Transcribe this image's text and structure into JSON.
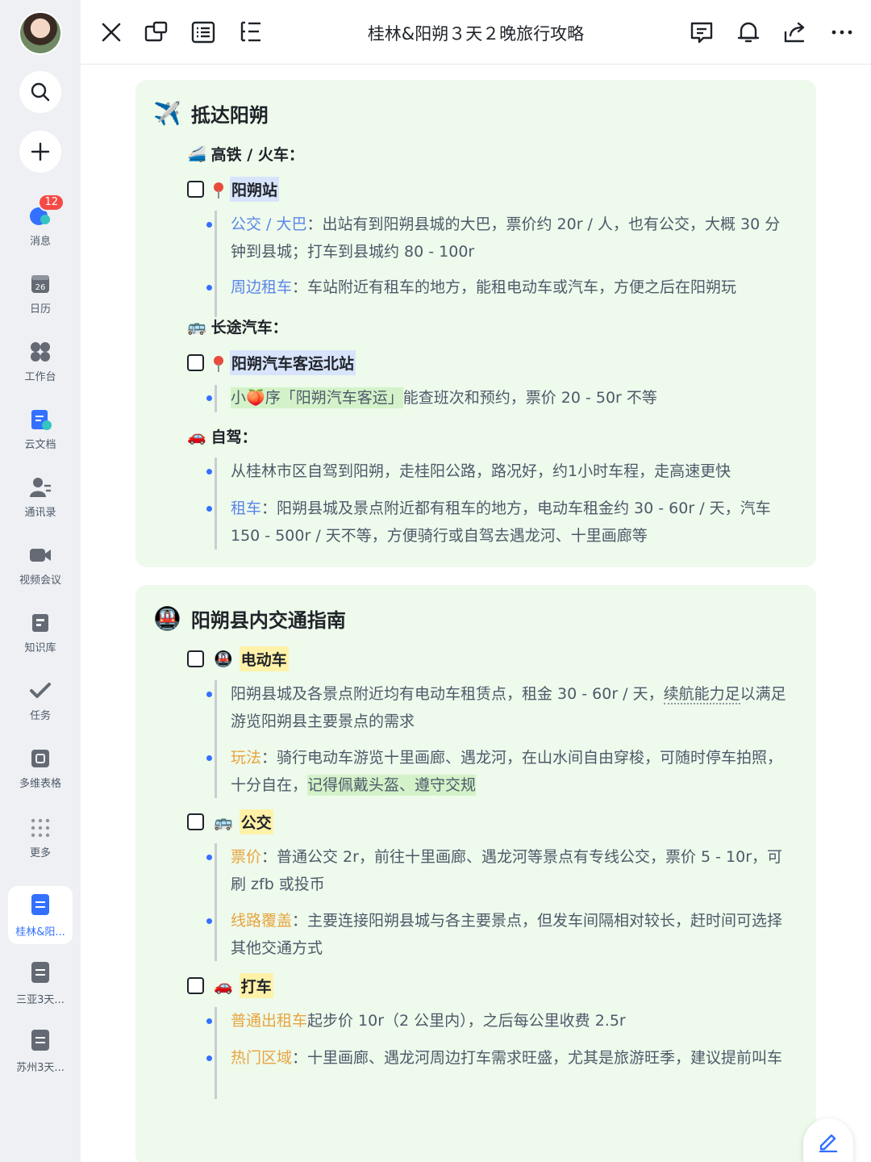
{
  "sidebar": {
    "badge": "12",
    "items": [
      {
        "label": "消息"
      },
      {
        "label": "日历",
        "day": "26"
      },
      {
        "label": "工作台"
      },
      {
        "label": "云文档"
      },
      {
        "label": "通讯录"
      },
      {
        "label": "视频会议"
      },
      {
        "label": "知识库"
      },
      {
        "label": "任务"
      },
      {
        "label": "多维表格"
      },
      {
        "label": "更多"
      }
    ],
    "docs": [
      {
        "label": "桂林&阳...",
        "active": true
      },
      {
        "label": "三亚3天..."
      },
      {
        "label": "苏州3天..."
      }
    ]
  },
  "header": {
    "title": "桂林&阳朔３天２晚旅行攻略"
  },
  "section1": {
    "heading": "抵达阳朔",
    "emoji": "✈️",
    "rail": {
      "emoji": "🚄",
      "label": "高铁 / 火车："
    },
    "station": "阳朔站",
    "bullet1_key": "公交 / 大巴",
    "bullet1_text": "：出站有到阳朔县城的大巴，票价约 20r / 人，也有公交，大概 30 分钟到县城；打车到县城约 80 - 100r",
    "bullet2_key": "周边租车",
    "bullet2_text": "：车站附近有租车的地方，能租电动车或汽车，方便之后在阳朔玩",
    "bus": {
      "emoji": "🚌",
      "label": "长途汽车："
    },
    "bus_station": "阳朔汽车客运北站",
    "bus_bullet_hl_a": "小",
    "bus_bullet_emoji": "🍑",
    "bus_bullet_hl_b": "序「阳朔汽车客运」",
    "bus_bullet_text": "能查班次和预约，票价 20 - 50r 不等",
    "drive": {
      "emoji": "🚗",
      "label": "自驾："
    },
    "drive_bullet1": "从桂林市区自驾到阳朔，走桂阳公路，路况好，约1小时车程，走高速更快",
    "drive_bullet2_key": "租车",
    "drive_bullet2_text": "：阳朔县城及景点附近都有租车的地方，电动车租金约 30 - 60r / 天，汽车 150 - 500r / 天不等，方便骑行或自驾去遇龙河、十里画廊等"
  },
  "section2": {
    "heading": "阳朔县内交通指南",
    "emoji": "🚇",
    "ebike": {
      "emoji": "🚇",
      "label": "电动车"
    },
    "ebike_b1_text": "阳朔县城及各景点附近均有电动车租赁点，租金 30 - 60r / 天，",
    "ebike_b1_dotted": "续航能力足",
    "ebike_b1_tail": "以满足游览阳朔县主要景点的需求",
    "ebike_b2_key": "玩法",
    "ebike_b2_text": "：骑行电动车游览十里画廊、遇龙河，在山水间自由穿梭，可随时停车拍照，十分自在，",
    "ebike_b2_hl": "记得佩戴头盔、遵守交规",
    "bus": {
      "emoji": "🚌",
      "label": "公交"
    },
    "bus_b1_key": "票价",
    "bus_b1_text": "：普通公交 2r，前往十里画廊、遇龙河等景点有专线公交，票价 5 - 10r，可刷 zfb 或投币",
    "bus_b2_key": "线路覆盖",
    "bus_b2_text": "：主要连接阳朔县城与各主要景点，但发车间隔相对较长，赶时间可选择其他交通方式",
    "taxi": {
      "emoji": "🚗",
      "label": "打车"
    },
    "taxi_b1_key": "普通出租车",
    "taxi_b1_text": "起步价 10r（2 公里内），之后每公里收费 2.5r",
    "taxi_b2_key": "热门区域",
    "taxi_b2_text": "：十里画廊、遇龙河周边打车需求旺盛，尤其是旅游旺季，建议提前叫车"
  },
  "colors": {
    "accent": "#3370ff",
    "card_bg": "#eefaec",
    "key_blue": "#5b86e8",
    "key_orange": "#e8a43f"
  }
}
